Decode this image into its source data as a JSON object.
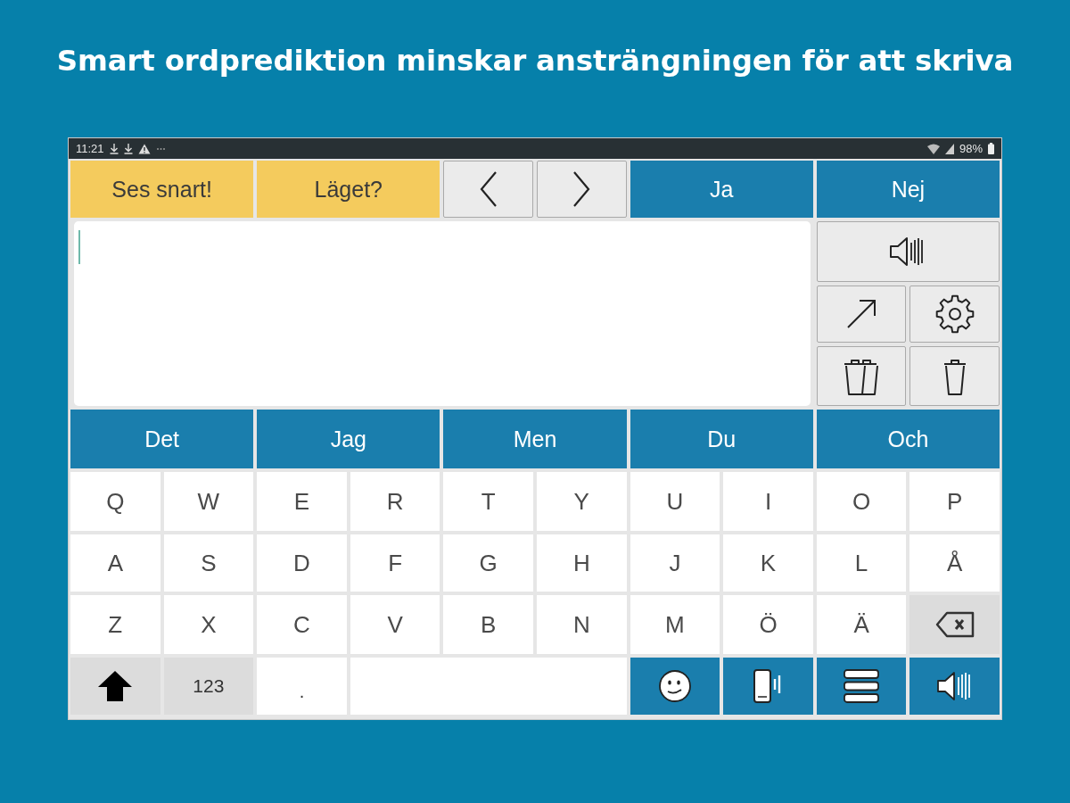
{
  "headline": "Smart ordprediktion minskar ansträngningen för att skriva",
  "status_bar": {
    "time": "11:21",
    "battery": "98%"
  },
  "top_bar": [
    {
      "kind": "phrase",
      "label": "Ses snart!"
    },
    {
      "kind": "phrase",
      "label": "Läget?"
    },
    {
      "kind": "back"
    },
    {
      "kind": "forward"
    },
    {
      "kind": "answer",
      "label": "Ja"
    },
    {
      "kind": "answer",
      "label": "Nej"
    }
  ],
  "predictions": [
    "Det",
    "Jag",
    "Men",
    "Du",
    "Och"
  ],
  "keyboard": {
    "rows": [
      [
        {
          "kind": "letter",
          "label": "Q"
        },
        {
          "kind": "letter",
          "label": "W"
        },
        {
          "kind": "letter",
          "label": "E"
        },
        {
          "kind": "letter",
          "label": "R"
        },
        {
          "kind": "letter",
          "label": "T"
        },
        {
          "kind": "letter",
          "label": "Y"
        },
        {
          "kind": "letter",
          "label": "U"
        },
        {
          "kind": "letter",
          "label": "I"
        },
        {
          "kind": "letter",
          "label": "O"
        },
        {
          "kind": "letter",
          "label": "P"
        }
      ],
      [
        {
          "kind": "letter",
          "label": "A"
        },
        {
          "kind": "letter",
          "label": "S"
        },
        {
          "kind": "letter",
          "label": "D"
        },
        {
          "kind": "letter",
          "label": "F"
        },
        {
          "kind": "letter",
          "label": "G"
        },
        {
          "kind": "letter",
          "label": "H"
        },
        {
          "kind": "letter",
          "label": "J"
        },
        {
          "kind": "letter",
          "label": "K"
        },
        {
          "kind": "letter",
          "label": "L"
        },
        {
          "kind": "letter",
          "label": "Å"
        }
      ],
      [
        {
          "kind": "letter",
          "label": "Z"
        },
        {
          "kind": "letter",
          "label": "X"
        },
        {
          "kind": "letter",
          "label": "C"
        },
        {
          "kind": "letter",
          "label": "V"
        },
        {
          "kind": "letter",
          "label": "B"
        },
        {
          "kind": "letter",
          "label": "N"
        },
        {
          "kind": "letter",
          "label": "M"
        },
        {
          "kind": "letter",
          "label": "Ö"
        },
        {
          "kind": "letter",
          "label": "Ä"
        },
        {
          "kind": "backspace"
        }
      ],
      [
        {
          "kind": "shift"
        },
        {
          "kind": "mode",
          "label": "123"
        },
        {
          "kind": "punctuation",
          "label": "."
        },
        {
          "kind": "space"
        },
        {
          "kind": "emoji"
        },
        {
          "kind": "phone"
        },
        {
          "kind": "menu"
        },
        {
          "kind": "speak"
        }
      ]
    ]
  }
}
